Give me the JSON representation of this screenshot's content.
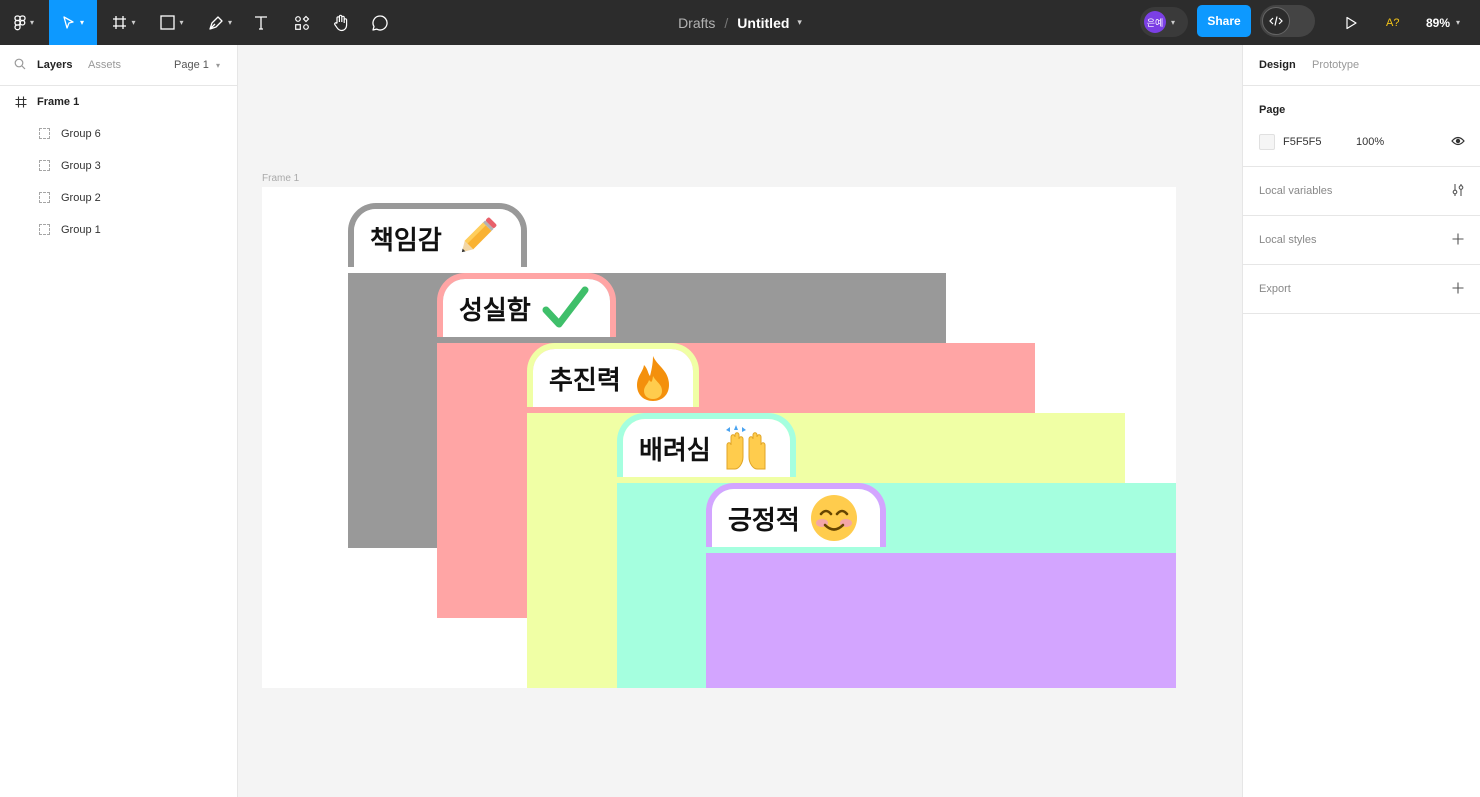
{
  "toolbar": {
    "breadcrumb": "Drafts",
    "separator": "/",
    "file_name": "Untitled",
    "avatar_initials": "은예",
    "share_label": "Share",
    "a11y_label": "A?",
    "zoom": "89%",
    "accent": "#0d99ff"
  },
  "left_panel": {
    "tabs": {
      "layers": "Layers",
      "assets": "Assets"
    },
    "page_selector": "Page 1",
    "layers": [
      {
        "name": "Frame 1",
        "type": "frame"
      },
      {
        "name": "Group 6",
        "type": "group"
      },
      {
        "name": "Group 3",
        "type": "group"
      },
      {
        "name": "Group 2",
        "type": "group"
      },
      {
        "name": "Group 1",
        "type": "group"
      }
    ]
  },
  "canvas": {
    "frame_label": "Frame 1",
    "cards": [
      {
        "label": "책임감",
        "emoji": "pencil",
        "color": "#999999"
      },
      {
        "label": "성실함",
        "emoji": "check-mark",
        "color": "#ffa5a5"
      },
      {
        "label": "추진력",
        "emoji": "fire",
        "color": "#f0ffa5"
      },
      {
        "label": "배려심",
        "emoji": "raising-hands",
        "color": "#a5ffdf"
      },
      {
        "label": "긍정적",
        "emoji": "smiling-face",
        "color": "#d3a5ff"
      }
    ]
  },
  "right_panel": {
    "tabs": {
      "design": "Design",
      "prototype": "Prototype"
    },
    "page": {
      "heading": "Page",
      "color": "F5F5F5",
      "opacity": "100%"
    },
    "local_variables": "Local variables",
    "local_styles": "Local styles",
    "export": "Export"
  }
}
